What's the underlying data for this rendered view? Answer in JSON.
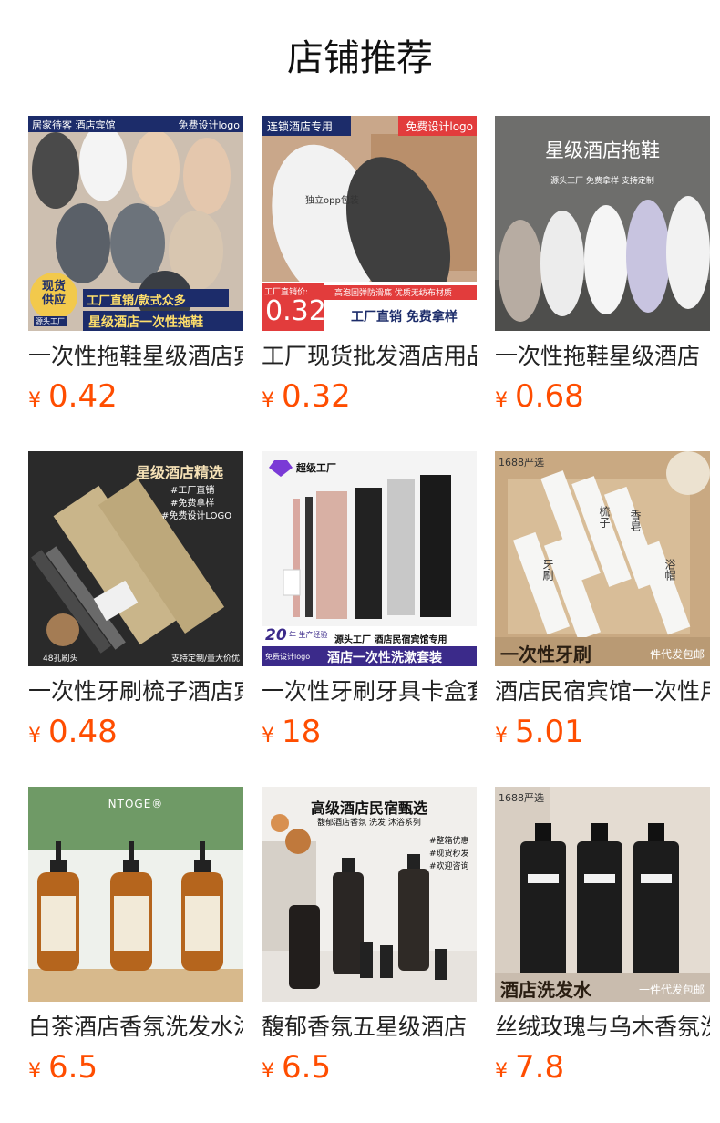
{
  "section": {
    "title": "店铺推荐"
  },
  "colors": {
    "price": "#ff4d00",
    "title": "#111111",
    "text": "#222222",
    "banner_navy": "#1c2c6a",
    "badge_red": "#e23c3c"
  },
  "products": [
    {
      "name": "一次性拖鞋星级酒店宾馆",
      "currency": "¥",
      "price": "0.42",
      "image": {
        "icon": "slippers-image",
        "top_left": "居家待客 酒店宾馆",
        "top_right": "免费设计logo",
        "badge": "现货供应",
        "badge_sub": "源头工厂",
        "line1": "工厂直销/款式众多",
        "line2": "星级酒店一次性拖鞋"
      }
    },
    {
      "name": "工厂现货批发酒店用品",
      "currency": "¥",
      "price": "0.32",
      "image": {
        "icon": "slippers-image",
        "top_left": "连锁酒店专用",
        "top_right": "免费设计logo",
        "center": "独立opp包装",
        "price_label": "工厂直销价:",
        "big_price": "0.32",
        "strip": "高泡回弹防滑底  优质无纺布材质",
        "line": "工厂直销 免费拿样"
      }
    },
    {
      "name": "一次性拖鞋星级酒店",
      "currency": "¥",
      "price": "0.68",
      "image": {
        "icon": "slippers-image",
        "headline": "星级酒店拖鞋",
        "tags": "源头工厂  免费拿样  支持定制"
      }
    },
    {
      "name": "一次性牙刷梳子酒店宾馆",
      "currency": "¥",
      "price": "0.48",
      "image": {
        "icon": "toothbrush-image",
        "headline": "星级酒店精选",
        "tag1": "#工厂直销",
        "tag2": "#免费拿样",
        "tag3": "#免费设计LOGO",
        "bottom_left": "48孔刷头",
        "bottom_right": "支持定制/量大价优"
      }
    },
    {
      "name": "一次性牙刷牙具卡盒套装",
      "currency": "¥",
      "price": "18",
      "image": {
        "icon": "toothbrush-image",
        "brand": "超级工厂",
        "years": "20",
        "years_sub": "年 生产经验",
        "free_logo": "免费设计logo",
        "line1": "源头工厂 酒店民宿宾馆专用",
        "line2": "酒店一次性洗漱套装"
      }
    },
    {
      "name": "酒店民宿宾馆一次性用品",
      "currency": "¥",
      "price": "5.01",
      "image": {
        "icon": "toothbrush-kit-image",
        "corner": "1688严选",
        "label1": "牙刷",
        "label2": "梳子",
        "label3": "浴帽",
        "label4": "香皂",
        "bottom": "一次性牙刷",
        "bottom_right": "一件代发包邮"
      }
    },
    {
      "name": "白茶酒店香氛洗发水沐浴露",
      "currency": "¥",
      "price": "6.5",
      "image": {
        "icon": "shampoo-bottles-image",
        "brand": "NTOGE®"
      }
    },
    {
      "name": "馥郁香氛五星级酒店",
      "currency": "¥",
      "price": "6.5",
      "image": {
        "icon": "shampoo-bottles-image",
        "headline": "高级酒店民宿甄选",
        "sub": "馥郁酒店香氛 洗发 沐浴系列",
        "tag1": "#整箱优惠",
        "tag2": "#现货秒发",
        "tag3": "#欢迎咨询"
      }
    },
    {
      "name": "丝绒玫瑰与乌木香氛洗发水",
      "currency": "¥",
      "price": "7.8",
      "image": {
        "icon": "shampoo-bottles-image",
        "corner": "1688严选",
        "bottom": "酒店洗发水",
        "bottom_right": "一件代发包邮"
      }
    }
  ]
}
